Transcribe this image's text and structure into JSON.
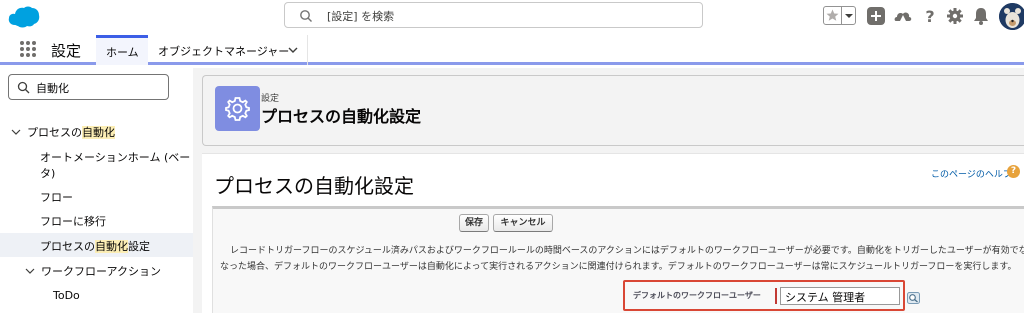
{
  "header": {
    "search_placeholder": "[設定] を検索"
  },
  "nav": {
    "app_name": "設定",
    "tabs": [
      {
        "label": "ホーム"
      },
      {
        "label": "オブジェクトマネージャー"
      }
    ]
  },
  "sidebar": {
    "quickfind_value": "自動化",
    "items": [
      {
        "label_prefix": "プロセスの",
        "label_highlight": "自動化",
        "label_suffix": ""
      },
      {
        "label": "オートメーションホーム (ベー"
      },
      {
        "label": "タ)"
      },
      {
        "label": "フロー"
      },
      {
        "label": "フローに移行"
      },
      {
        "label_prefix": "プロセスの",
        "label_highlight": "自動化",
        "label_suffix": "設定"
      },
      {
        "label": "ワークフローアクション"
      },
      {
        "label": "ToDo"
      }
    ]
  },
  "page_header": {
    "eyebrow": "設定",
    "title": "プロセスの自動化設定"
  },
  "main": {
    "title": "プロセスの自動化設定",
    "help_link": "このページのヘルプ",
    "help_icon_text": "?",
    "save_label": "保存",
    "cancel_label": "キャンセル",
    "info_line1": "レコードトリガーフローのスケジュール済みパスおよびワークフロールールの時間ベースのアクションにはデフォルトのワークフローユーザーが必要です。自動化をトリガーしたユーザーが有効でなく",
    "info_line2": "なった場合、デフォルトのワークフローユーザーは自動化によって実行されるアクションに関連付けられます。デフォルトのワークフローユーザーは常にスケジュールトリガーフローを実行します。",
    "field_label": "デフォルトのワークフローユーザー",
    "field_value": "システム 管理者"
  },
  "icons": {
    "logo": "salesforce-cloud-icon",
    "search": "search-icon",
    "favorites": "star-icon",
    "add": "add-icon",
    "trailhead": "trailhead-icon",
    "help": "help-icon",
    "setup": "gear-icon",
    "notifications": "bell-icon",
    "app_launcher": "waffle-icon",
    "lookup": "lookup-icon"
  },
  "colors": {
    "brand_blue": "#00a1e0",
    "nav_accent": "#3c5ee6",
    "page_icon_bg": "#7f8de1",
    "highlight": "#fceeb5",
    "required_border": "#d94735",
    "link": "#015ba7"
  }
}
